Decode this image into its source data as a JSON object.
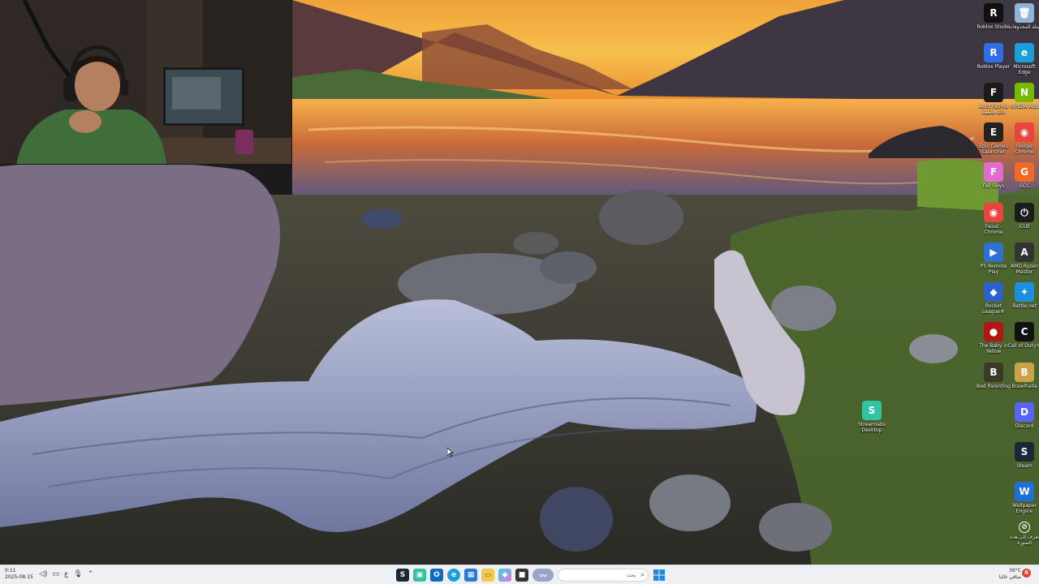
{
  "desktop_icons": [
    {
      "label": "Roblox Studio",
      "icon": "roblox-studio-icon",
      "glyph": "R",
      "bg": "#111111"
    },
    {
      "label": "سلة المحذوفات",
      "icon": "recycle-bin-icon",
      "glyph": "🗑",
      "bg": "#8fb4d8"
    },
    {
      "label": "Roblox Player",
      "icon": "roblox-player-icon",
      "glyph": "R",
      "bg": "#2f6ee8"
    },
    {
      "label": "Microsoft Edge",
      "icon": "edge-icon",
      "glyph": "e",
      "bg": "#1a9fd9"
    },
    {
      "label": "Aunt Fatima خالة فاطمة",
      "icon": "aunt-fatima-icon",
      "glyph": "F",
      "bg": "#1b1b1b"
    },
    {
      "label": "NVIDIA App",
      "icon": "nvidia-icon",
      "glyph": "N",
      "bg": "#76b900"
    },
    {
      "label": "Epic Games Launcher",
      "icon": "epic-games-icon",
      "glyph": "E",
      "bg": "#222222"
    },
    {
      "label": "Google Chrome",
      "icon": "chrome-icon",
      "glyph": "◉",
      "bg": "#e8453c"
    },
    {
      "label": "Fall Guys",
      "icon": "fall-guys-icon",
      "glyph": "F",
      "bg": "#e36bd0"
    },
    {
      "label": "GCC",
      "icon": "gcc-icon",
      "glyph": "G",
      "bg": "#f06a25"
    },
    {
      "label": "Faisal - Chrome",
      "icon": "chrome-profile-icon",
      "glyph": "◉",
      "bg": "#e8453c"
    },
    {
      "label": "iCUE",
      "icon": "icue-icon",
      "glyph": "⏻",
      "bg": "#1c1c1c"
    },
    {
      "label": "PS Remote Play",
      "icon": "ps-remote-play-icon",
      "glyph": "▶",
      "bg": "#2f6fcf"
    },
    {
      "label": "AMD Ryzen Master",
      "icon": "amd-ryzen-icon",
      "glyph": "A",
      "bg": "#333333"
    },
    {
      "label": "Rocket League®",
      "icon": "rocket-league-icon",
      "glyph": "◆",
      "bg": "#2a62c9"
    },
    {
      "label": "Battle.net",
      "icon": "battle-net-icon",
      "glyph": "✦",
      "bg": "#1e8fe0"
    },
    {
      "label": "The Baby in Yellow",
      "icon": "baby-in-yellow-icon",
      "glyph": "●",
      "bg": "#b11616"
    },
    {
      "label": "Call of Duty®",
      "icon": "call-of-duty-icon",
      "glyph": "C",
      "bg": "#111111"
    },
    {
      "label": "Bad Parenting",
      "icon": "bad-parenting-icon",
      "glyph": "B",
      "bg": "#3b3a26"
    },
    {
      "label": "Brawlhalla",
      "icon": "brawlhalla-icon",
      "glyph": "B",
      "bg": "#c9a24a"
    },
    {
      "label": "Streamlabs Desktop",
      "icon": "streamlabs-icon",
      "glyph": "S",
      "bg": "#31c3a2"
    },
    {
      "label": "Discord",
      "icon": "discord-icon",
      "glyph": "D",
      "bg": "#5865f2"
    },
    {
      "label": "Steam",
      "icon": "steam-icon",
      "glyph": "S",
      "bg": "#1b2838"
    },
    {
      "label": "Wallpaper Engine",
      "icon": "wallpaper-engine-icon",
      "glyph": "W",
      "bg": "#1f6fd6"
    },
    {
      "label": "تعرف إلى هذه الصورة",
      "icon": "learn-about-picture-icon",
      "glyph": "⊘",
      "bg": "transparent"
    }
  ],
  "taskbar": {
    "time": "0:11",
    "date": "2025-08-15",
    "lang": "ع",
    "search_placeholder": "بحث",
    "weather_temp": "36°C",
    "weather_desc": "صافي غالبا",
    "notification_count": "6"
  }
}
